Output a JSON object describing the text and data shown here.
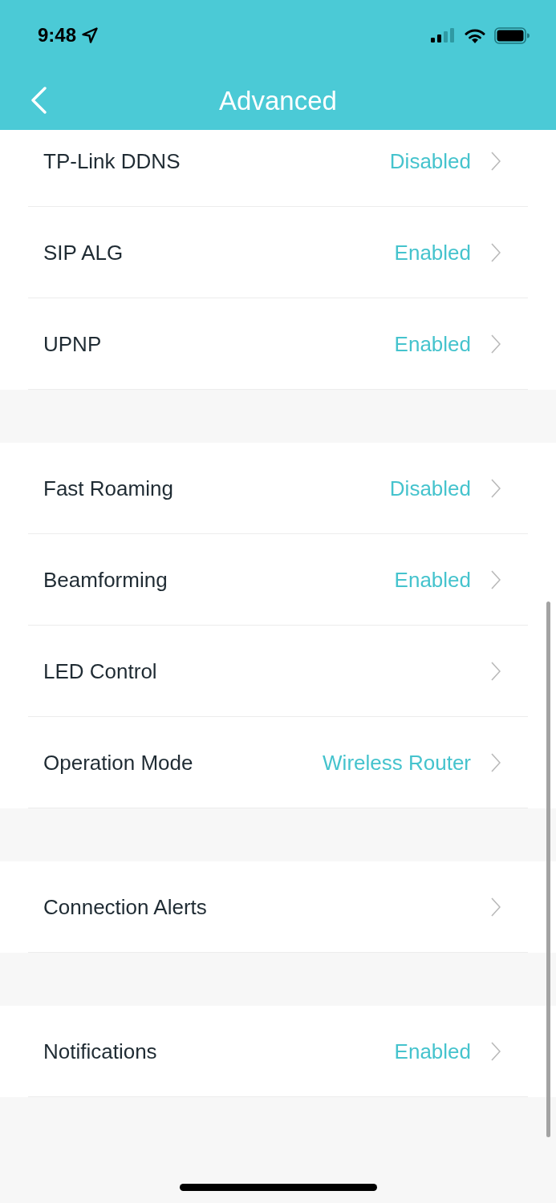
{
  "status_bar": {
    "time": "9:48"
  },
  "nav_bar": {
    "title": "Advanced"
  },
  "sections": [
    {
      "items": [
        {
          "label": "TP-Link DDNS",
          "value": "Disabled"
        },
        {
          "label": "SIP ALG",
          "value": "Enabled"
        },
        {
          "label": "UPNP",
          "value": "Enabled"
        }
      ]
    },
    {
      "items": [
        {
          "label": "Fast Roaming",
          "value": "Disabled"
        },
        {
          "label": "Beamforming",
          "value": "Enabled"
        },
        {
          "label": "LED Control"
        },
        {
          "label": "Operation Mode",
          "value": "Wireless Router"
        }
      ]
    },
    {
      "items": [
        {
          "label": "Connection Alerts"
        }
      ]
    },
    {
      "items": [
        {
          "label": "Notifications",
          "value": "Enabled"
        }
      ]
    }
  ]
}
